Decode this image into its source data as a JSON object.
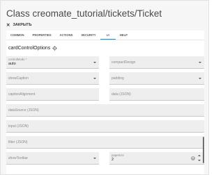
{
  "dialog": {
    "title": "Class creomate_tutorial/tickets/Ticket",
    "close_label": "ЗАКРЫТЬ"
  },
  "tabs": [
    {
      "label": "COMMON"
    },
    {
      "label": "PROPERTIES"
    },
    {
      "label": "ACTIONS"
    },
    {
      "label": "SECURITY"
    },
    {
      "label": "UI",
      "active": true
    },
    {
      "label": "HELP"
    }
  ],
  "section": {
    "title": "cardControlOptions",
    "icon": "gear-icon"
  },
  "fields": {
    "controlMode": {
      "label": "controlMode *",
      "value": "auto"
    },
    "compactDesign": {
      "label": "compactDesign"
    },
    "showCaption": {
      "label": "showCaption"
    },
    "padding": {
      "label": "padding"
    },
    "captionAlignment": {
      "label": "captionAlignment"
    },
    "data": {
      "label": "data (JSON)"
    },
    "dataSource": {
      "label": "dataSource (JSON)"
    },
    "input": {
      "label": "input (JSON)"
    },
    "filter": {
      "label": "filter (JSON)"
    },
    "showToolbar": {
      "label": "showToolbar"
    },
    "pageSize": {
      "label": "pageSize",
      "value": "2"
    }
  },
  "colors": {
    "accent": "#3b82d6",
    "field_bg": "#eeeeee",
    "dialog_bg": "#f6f6f6"
  }
}
